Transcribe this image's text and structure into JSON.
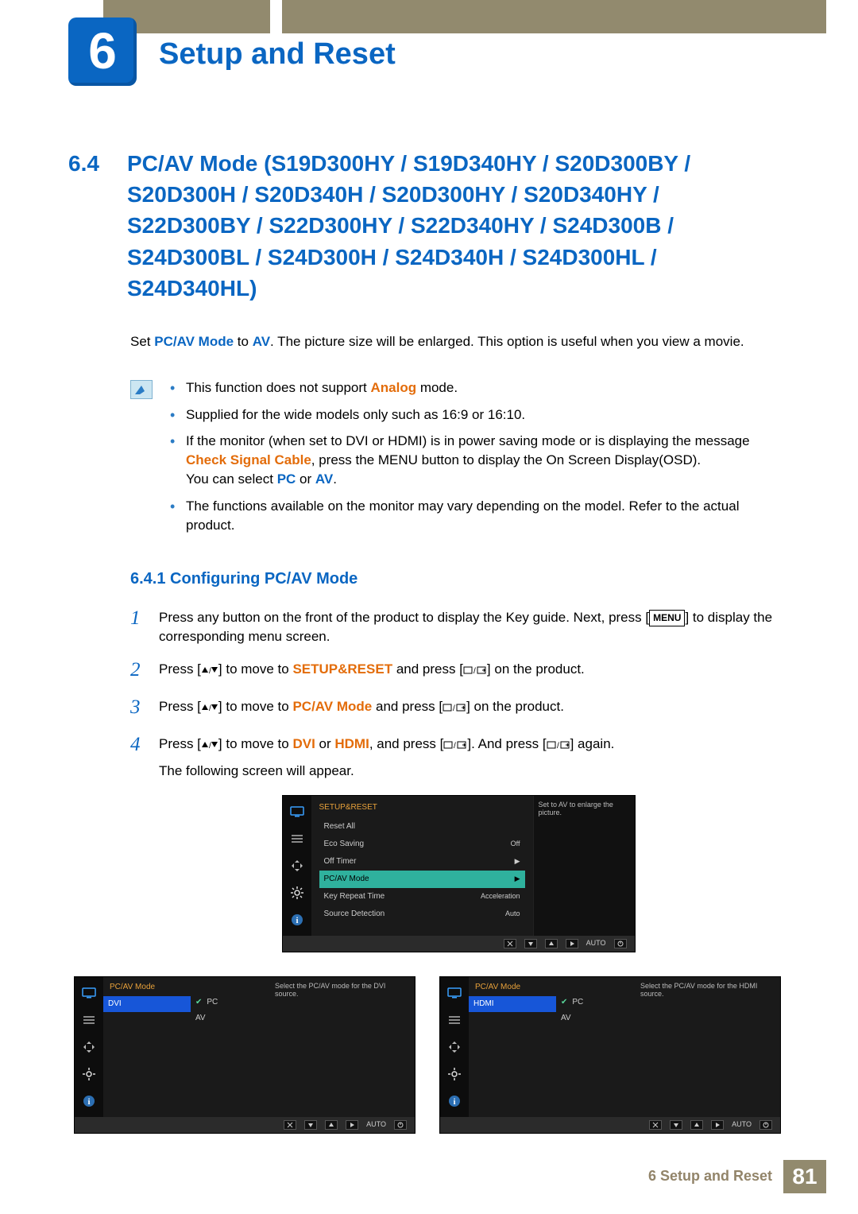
{
  "chapter": {
    "number": "6",
    "title": "Setup and Reset"
  },
  "section": {
    "number": "6.4",
    "title": "PC/AV Mode (S19D300HY / S19D340HY / S20D300BY / S20D300H / S20D340H / S20D300HY / S20D340HY / S22D300BY / S22D300HY / S22D340HY / S24D300B / S24D300BL / S24D300H / S24D340H / S24D300HL / S24D340HL)"
  },
  "intro": {
    "pre": "Set ",
    "mode": "PC/AV Mode",
    "mid": " to ",
    "av": "AV",
    "post": ". The picture size will be enlarged. This option is useful when you view a movie."
  },
  "notes": {
    "n1_pre": "This function does not support ",
    "n1_em": "Analog",
    "n1_post": " mode.",
    "n2": "Supplied for the wide models only such as 16:9 or 16:10.",
    "n3_pre": "If the monitor (when set to DVI or HDMI) is in power saving mode or is displaying the message ",
    "n3_em": "Check Signal Cable",
    "n3_mid": ", press the MENU button to display the On Screen Display(OSD).",
    "n3_you": "You can select ",
    "n3_pc": "PC",
    "n3_or": " or ",
    "n3_av": "AV",
    "n3_dot": ".",
    "n4": "The functions available on the monitor may vary depending on the model. Refer to the actual product."
  },
  "subsection": {
    "number_title": "6.4.1   Configuring PC/AV Mode"
  },
  "steps": {
    "s1_n": "1",
    "s1_a": "Press any button on the front of the product to display the Key guide. Next, press [",
    "s1_menu": "MENU",
    "s1_b": "] to display the corresponding menu screen.",
    "s2_n": "2",
    "s2_a": "Press [",
    "s2_b": "] to move to ",
    "s2_em": "SETUP&RESET",
    "s2_c": " and press [",
    "s2_d": "] on the product.",
    "s3_n": "3",
    "s3_a": "Press [",
    "s3_b": "] to move to ",
    "s3_em": "PC/AV Mode",
    "s3_c": " and press [",
    "s3_d": "] on the product.",
    "s4_n": "4",
    "s4_a": "Press [",
    "s4_b": "] to move to ",
    "s4_em1": "DVI",
    "s4_or": " or ",
    "s4_em2": "HDMI",
    "s4_c": ", and press [",
    "s4_d": "]. And press [",
    "s4_e": "] again.",
    "s4_f": "The following screen will appear."
  },
  "osd_main": {
    "title": "SETUP&RESET",
    "rows": [
      {
        "label": "Reset All",
        "value": ""
      },
      {
        "label": "Eco Saving",
        "value": "Off"
      },
      {
        "label": "Off Timer",
        "value": "▶"
      },
      {
        "label": "PC/AV Mode",
        "value": "▶",
        "sel": true
      },
      {
        "label": "Key Repeat Time",
        "value": "Acceleration"
      },
      {
        "label": "Source Detection",
        "value": "Auto"
      }
    ],
    "help": "Set to AV to enlarge the picture.",
    "auto": "AUTO"
  },
  "osd_dvi": {
    "title": "PC/AV Mode",
    "source": "DVI",
    "opt_pc": "PC",
    "opt_av": "AV",
    "help": "Select the PC/AV mode for the DVI source.",
    "auto": "AUTO"
  },
  "osd_hdmi": {
    "title": "PC/AV Mode",
    "source": "HDMI",
    "opt_pc": "PC",
    "opt_av": "AV",
    "help": "Select the PC/AV mode for the HDMI source.",
    "auto": "AUTO"
  },
  "footer": {
    "label": "6 Setup and Reset",
    "page": "81"
  }
}
